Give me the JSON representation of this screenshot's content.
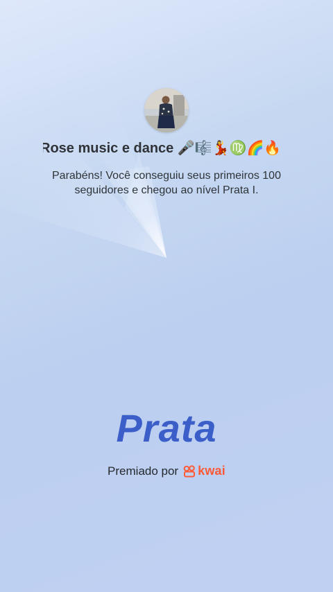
{
  "profile": {
    "avatar_alt": "profile photo",
    "username": "Rose music e dance 🎤🎼💃♍🌈🔥"
  },
  "message": "Parabéns! Você conseguiu seus primeiros 100 seguidores e chegou ao nível Prata I.",
  "level": {
    "title": "Prata",
    "color": "#3c5ec9"
  },
  "footer": {
    "awarded_label": "Premiado por",
    "brand_icon": "kwai-logo-icon",
    "brand_name": "kwai",
    "brand_color": "#ff5a37"
  }
}
